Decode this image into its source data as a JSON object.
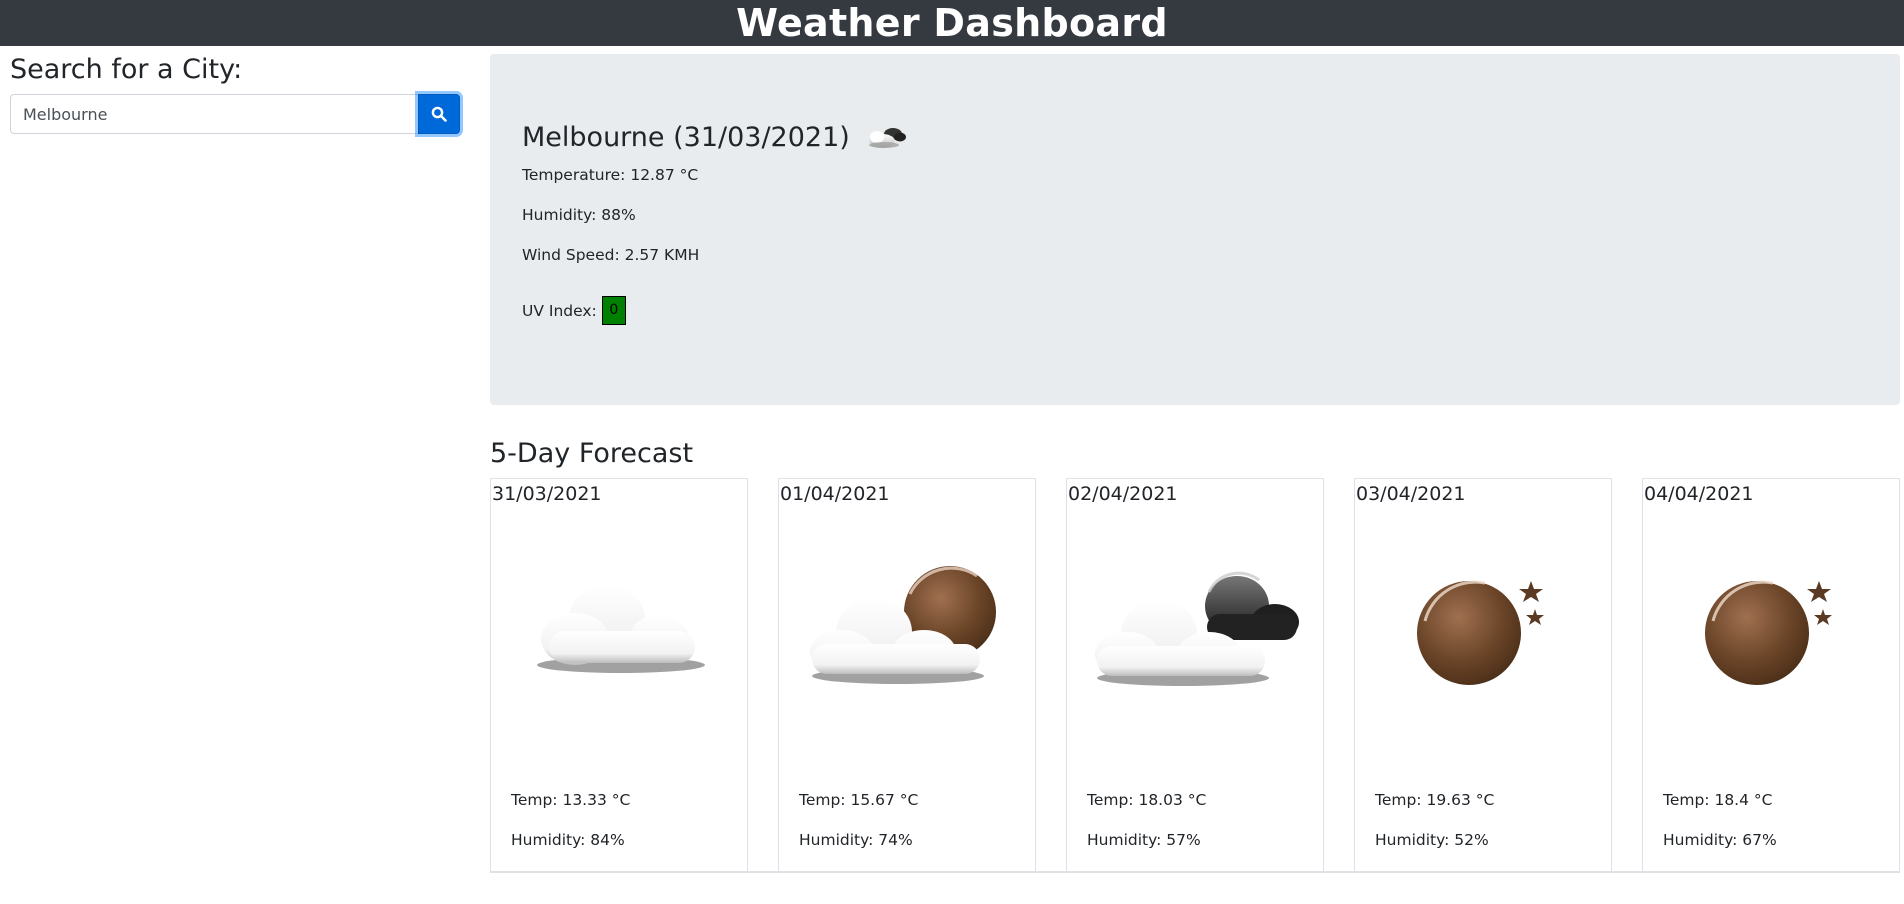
{
  "header": {
    "title": "Weather Dashboard"
  },
  "search": {
    "heading": "Search for a City:",
    "value": "Melbourne",
    "button_icon": "search-icon"
  },
  "current": {
    "city_date": "Melbourne (31/03/2021)",
    "icon": "cloud-night-icon",
    "temperature": "Temperature: 12.87 °C",
    "humidity": "Humidity: 88%",
    "wind": "Wind Speed: 2.57 KMH",
    "uv_label": "UV Index:",
    "uv_value": "0",
    "uv_color": "#008000"
  },
  "forecast": {
    "heading": "5-Day Forecast",
    "days": [
      {
        "date": "31/03/2021",
        "icon": "cloud-icon",
        "temp": "Temp: 13.33 °C",
        "humidity": "Humidity: 84%"
      },
      {
        "date": "01/04/2021",
        "icon": "cloud-moon-icon",
        "temp": "Temp: 15.67 °C",
        "humidity": "Humidity: 74%"
      },
      {
        "date": "02/04/2021",
        "icon": "cloud-dark-cloud-icon",
        "temp": "Temp: 18.03 °C",
        "humidity": "Humidity: 57%"
      },
      {
        "date": "03/04/2021",
        "icon": "moon-stars-icon",
        "temp": "Temp: 19.63 °C",
        "humidity": "Humidity: 52%"
      },
      {
        "date": "04/04/2021",
        "icon": "moon-stars-icon",
        "temp": "Temp: 18.4 °C",
        "humidity": "Humidity: 67%"
      }
    ]
  },
  "colors": {
    "header_bg": "#343a40",
    "jumbotron_bg": "#e9ecef",
    "primary": "#0069d9"
  }
}
